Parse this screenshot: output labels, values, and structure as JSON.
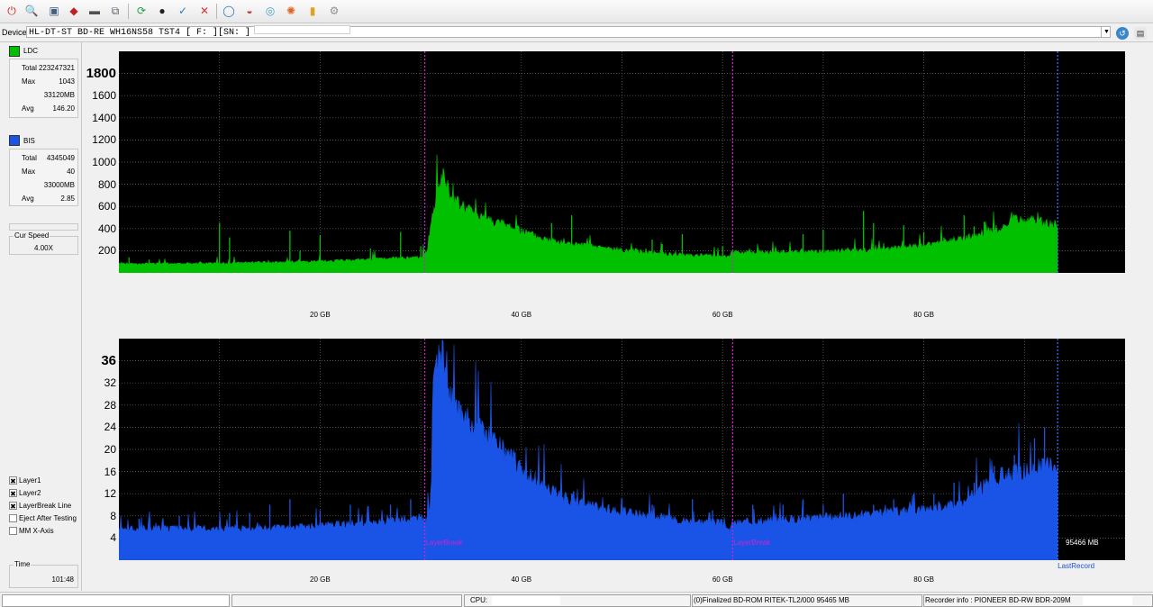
{
  "toolbar": {
    "buttons": [
      {
        "name": "power-icon",
        "glyph": "⏻",
        "color": "#d42020"
      },
      {
        "name": "disc-info-icon",
        "glyph": "🔍",
        "color": "#2060c0"
      },
      {
        "name": "drive-icon",
        "glyph": "▣",
        "color": "#406080"
      },
      {
        "name": "burn-icon",
        "glyph": "◆",
        "color": "#c02020"
      },
      {
        "name": "eject-icon",
        "glyph": "▬",
        "color": "#505050"
      },
      {
        "name": "copy-icon",
        "glyph": "⧉",
        "color": "#606070"
      },
      {
        "name": "refresh-icon",
        "glyph": "⟳",
        "color": "#20a040"
      },
      {
        "name": "scan-icon",
        "glyph": "●",
        "color": "#202020"
      },
      {
        "name": "check-icon",
        "glyph": "✓",
        "color": "#2080c0"
      },
      {
        "name": "stop-icon",
        "glyph": "✕",
        "color": "#e03030"
      },
      {
        "name": "globe-icon",
        "glyph": "◯",
        "color": "#3070c0"
      },
      {
        "name": "erase-icon",
        "glyph": "◒",
        "color": "#c04040"
      },
      {
        "name": "test-icon",
        "glyph": "◎",
        "color": "#40a0c0"
      },
      {
        "name": "fire-icon",
        "glyph": "✺",
        "color": "#e06020"
      },
      {
        "name": "chart-icon",
        "glyph": "▮",
        "color": "#e0a020"
      },
      {
        "name": "settings-icon",
        "glyph": "⚙",
        "color": "#909090"
      }
    ]
  },
  "device": {
    "label": "Device:",
    "value": "HL-DT-ST BD-RE  WH16NS58  TST4 [ F: ][SN:              ]"
  },
  "sidebar": {
    "ldc": {
      "label": "LDC",
      "color": "#00c000",
      "rows": [
        {
          "k": "Total",
          "v": "223247321"
        },
        {
          "k": "Max",
          "v": "1043"
        },
        {
          "k": "",
          "v": "33120MB"
        },
        {
          "k": "Avg",
          "v": "146.20"
        }
      ]
    },
    "bis": {
      "label": "BIS",
      "color": "#1a54e6",
      "rows": [
        {
          "k": "Total",
          "v": "4345049"
        },
        {
          "k": "Max",
          "v": "40"
        },
        {
          "k": "",
          "v": "33000MB"
        },
        {
          "k": "Avg",
          "v": "2.85"
        }
      ]
    },
    "cur_speed": {
      "label": "Cur Speed",
      "value": "4.00X"
    },
    "options": [
      {
        "label": "Layer1",
        "checked": true
      },
      {
        "label": "Layer2",
        "checked": true
      },
      {
        "label": "LayerBreak Line",
        "checked": true
      },
      {
        "label": "Eject After Testing",
        "checked": false
      },
      {
        "label": "MM X-Axis",
        "checked": false
      }
    ],
    "time": {
      "label": "Time",
      "value": "101:48"
    }
  },
  "chart_data": [
    {
      "type": "area",
      "series": [
        {
          "name": "LDC",
          "color": "#00c000"
        }
      ],
      "x_unit": "GB",
      "xlim": [
        0,
        100
      ],
      "ylim": [
        0,
        2000
      ],
      "y_ticks": [
        {
          "v": 1800,
          "label": "1800",
          "big": true
        },
        {
          "v": 1600,
          "label": "1600"
        },
        {
          "v": 1400,
          "label": "1400"
        },
        {
          "v": 1200,
          "label": "1200"
        },
        {
          "v": 1000,
          "label": "1000"
        },
        {
          "v": 800,
          "label": "800"
        },
        {
          "v": 600,
          "label": "600"
        },
        {
          "v": 400,
          "label": "400"
        },
        {
          "v": 200,
          "label": "200"
        }
      ],
      "x_ticks": [
        {
          "v": 20,
          "label": "20 GB"
        },
        {
          "v": 40,
          "label": "40 GB"
        },
        {
          "v": 60,
          "label": "60 GB"
        },
        {
          "v": 80,
          "label": "80 GB"
        }
      ],
      "profile": [
        [
          0,
          80
        ],
        [
          10,
          85
        ],
        [
          20,
          100
        ],
        [
          25,
          120
        ],
        [
          30,
          135
        ],
        [
          30.3,
          160
        ],
        [
          30.6,
          180
        ],
        [
          31.1,
          480
        ],
        [
          32.0,
          800
        ],
        [
          32.3,
          870
        ],
        [
          33,
          640
        ],
        [
          35,
          540
        ],
        [
          37,
          460
        ],
        [
          39,
          400
        ],
        [
          42,
          300
        ],
        [
          45,
          250
        ],
        [
          50,
          200
        ],
        [
          55,
          160
        ],
        [
          60,
          150
        ],
        [
          60.5,
          140
        ],
        [
          61,
          180
        ],
        [
          65,
          180
        ],
        [
          70,
          185
        ],
        [
          75,
          200
        ],
        [
          80,
          240
        ],
        [
          85,
          320
        ],
        [
          88,
          410
        ],
        [
          89,
          470
        ],
        [
          93.3,
          430
        ]
      ],
      "spikes": [
        [
          1,
          140
        ],
        [
          3,
          120
        ],
        [
          10,
          450
        ],
        [
          11,
          320
        ],
        [
          17,
          380
        ],
        [
          18,
          200
        ],
        [
          20,
          340
        ],
        [
          25,
          220
        ],
        [
          28,
          370
        ],
        [
          30,
          240
        ],
        [
          34,
          480
        ],
        [
          40,
          400
        ],
        [
          43,
          450
        ],
        [
          45,
          520
        ],
        [
          53,
          300
        ],
        [
          54,
          260
        ],
        [
          56,
          350
        ],
        [
          60,
          240
        ],
        [
          68,
          350
        ],
        [
          70,
          390
        ],
        [
          74,
          560
        ],
        [
          75,
          450
        ],
        [
          78,
          430
        ],
        [
          80,
          370
        ],
        [
          82,
          320
        ],
        [
          84,
          520
        ],
        [
          85,
          420
        ],
        [
          86,
          460
        ],
        [
          88,
          300
        ],
        [
          89,
          350
        ],
        [
          90,
          360
        ],
        [
          91,
          480
        ]
      ],
      "layer_breaks": [
        30.4,
        61
      ],
      "last_record": 93.3
    },
    {
      "type": "area",
      "series": [
        {
          "name": "BIS",
          "color": "#1a54e6"
        }
      ],
      "x_unit": "GB",
      "xlim": [
        0,
        100
      ],
      "ylim": [
        0,
        40
      ],
      "y_ticks": [
        {
          "v": 36,
          "label": "36",
          "big": true
        },
        {
          "v": 32,
          "label": "32"
        },
        {
          "v": 28,
          "label": "28"
        },
        {
          "v": 24,
          "label": "24"
        },
        {
          "v": 20,
          "label": "20"
        },
        {
          "v": 16,
          "label": "16"
        },
        {
          "v": 12,
          "label": "12"
        },
        {
          "v": 8,
          "label": "8"
        },
        {
          "v": 4,
          "label": "4"
        }
      ],
      "x_ticks": [
        {
          "v": 20,
          "label": "20 GB"
        },
        {
          "v": 40,
          "label": "40 GB"
        },
        {
          "v": 60,
          "label": "60 GB"
        },
        {
          "v": 80,
          "label": "80 GB"
        }
      ],
      "profile": [
        [
          0,
          5.5
        ],
        [
          15,
          5.6
        ],
        [
          25,
          6.5
        ],
        [
          30,
          7.5
        ],
        [
          30.4,
          6.5
        ],
        [
          31.0,
          8.0
        ],
        [
          31.2,
          30
        ],
        [
          32.0,
          36
        ],
        [
          32.5,
          35
        ],
        [
          33,
          28
        ],
        [
          35,
          24
        ],
        [
          37,
          21
        ],
        [
          39,
          18
        ],
        [
          41,
          14.5
        ],
        [
          44,
          11
        ],
        [
          48,
          9
        ],
        [
          52,
          8
        ],
        [
          56,
          7
        ],
        [
          60,
          6.5
        ],
        [
          60.5,
          5
        ],
        [
          61,
          6.5
        ],
        [
          65,
          7
        ],
        [
          70,
          7.5
        ],
        [
          75,
          8
        ],
        [
          80,
          9
        ],
        [
          84,
          10
        ],
        [
          86,
          13
        ],
        [
          88,
          15
        ],
        [
          90,
          15.5
        ],
        [
          93.3,
          17
        ]
      ],
      "spikes": [
        [
          2,
          7.5
        ],
        [
          6,
          8
        ],
        [
          11,
          8.5
        ],
        [
          13,
          8.5
        ],
        [
          15,
          10
        ],
        [
          17,
          11
        ],
        [
          20,
          9
        ],
        [
          23,
          10
        ],
        [
          27,
          10
        ],
        [
          29,
          11
        ],
        [
          34,
          28
        ],
        [
          36,
          23
        ],
        [
          38,
          20
        ],
        [
          40,
          17
        ],
        [
          45,
          12
        ],
        [
          50,
          11
        ],
        [
          53,
          10
        ],
        [
          57,
          11
        ],
        [
          59,
          9
        ],
        [
          63,
          10
        ],
        [
          66,
          10
        ],
        [
          68,
          11
        ],
        [
          70,
          10
        ],
        [
          72,
          12
        ],
        [
          75,
          10
        ],
        [
          77,
          11
        ],
        [
          79,
          12
        ],
        [
          81,
          12
        ],
        [
          83,
          14
        ],
        [
          85,
          14
        ],
        [
          87,
          17
        ],
        [
          89,
          19
        ],
        [
          91,
          22
        ],
        [
          92,
          24
        ]
      ],
      "layer_breaks": [
        30.4,
        61
      ],
      "last_record": 93.3,
      "annotations": {
        "layer_break": "LayerBreak",
        "capacity": "95466 MB",
        "last_record": "LastRecord"
      }
    }
  ],
  "status_bar": {
    "cpu_label": "CPU:",
    "disc_info": "(0)Finalized  BD-ROM  RITEK-TL2/000  95465 MB",
    "recorder_info": "Recorder info : PIONEER     BD-RW  BDR-209M"
  }
}
